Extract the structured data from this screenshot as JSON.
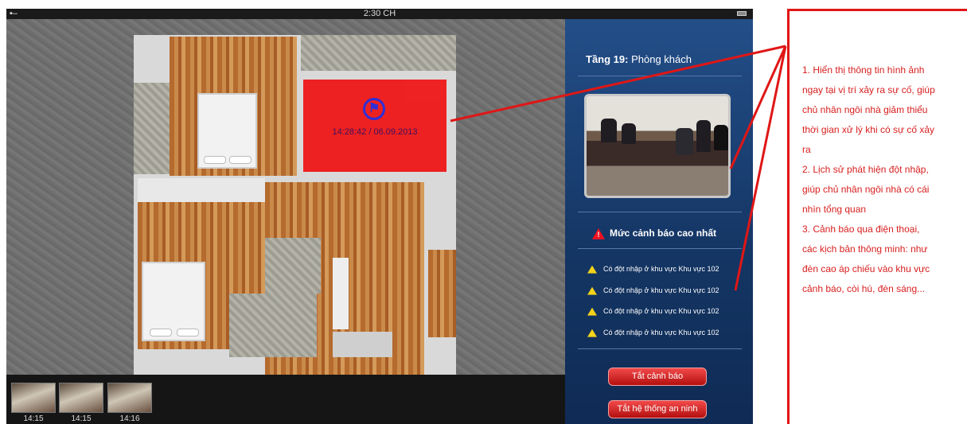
{
  "status_bar": {
    "time": "2:30 CH",
    "signal": "▪–"
  },
  "alarm": {
    "time_label": "14:28:42 / 06.09.2013",
    "icon": "running-person-icon"
  },
  "thumbnails": [
    {
      "time": "14:15"
    },
    {
      "time": "14:15"
    },
    {
      "time": "14:16"
    }
  ],
  "side_panel": {
    "room_prefix": "Tầng 19:",
    "room_name": "Phòng khách",
    "warning_level": "Mức cảnh báo cao nhất",
    "alerts": [
      "Có đột nhập ở khu vực Khu vực 102",
      "Có đột nhập ở khu vực Khu vực 102",
      "Có đột nhập ở khu vực Khu vực 102",
      "Có đột nhập ở khu vực Khu vực 102"
    ],
    "buttons": {
      "disable_alarm": "Tắt cảnh báo",
      "disable_security": "Tắt hệ thống an ninh"
    }
  },
  "annotation": {
    "lines": [
      "1. Hiển thị thông tin hình ảnh",
      "ngay tại vị trí xảy ra sự cố, giúp",
      " chủ nhân ngôi nhà giảm thiểu",
      "thời gian xử lý khi có sự cố xảy",
      "ra",
      "2. Lịch sử phát hiện đột nhập,",
      "giúp chủ nhân ngôi nhà có cái",
      " nhìn tổng quan",
      "3. Cảnh báo qua điện thoại,",
      "các kịch bản thông minh: như",
      "đèn cao áp chiếu vào khu vực",
      " cảnh báo, còi hú, đèn sáng..."
    ]
  },
  "colors": {
    "alarm_red": "#ee1c1c",
    "panel_blue": "#143563",
    "annotation_red": "#d81e1e",
    "alert_yellow": "#f2d21a"
  }
}
